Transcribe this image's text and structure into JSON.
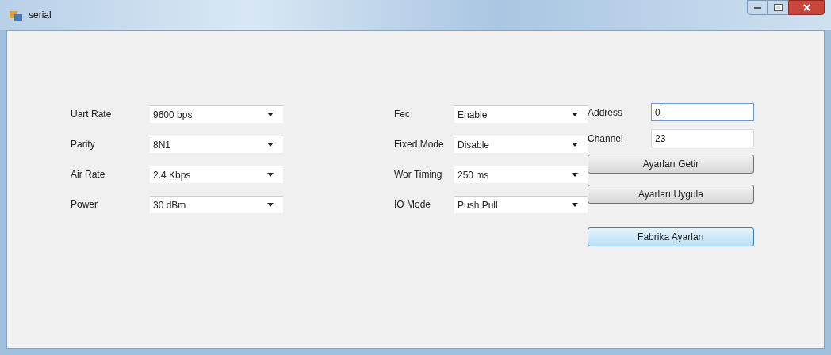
{
  "window": {
    "title": "serial"
  },
  "settings_left": [
    {
      "label": "Uart Rate",
      "value": "9600 bps"
    },
    {
      "label": "Parity",
      "value": "8N1"
    },
    {
      "label": "Air Rate",
      "value": "2.4 Kbps"
    },
    {
      "label": "Power",
      "value": "30 dBm"
    }
  ],
  "settings_middle": [
    {
      "label": "Fec",
      "value": "Enable"
    },
    {
      "label": "Fixed Mode",
      "value": "Disable"
    },
    {
      "label": "Wor Timing",
      "value": "250 ms"
    },
    {
      "label": "IO Mode",
      "value": "Push Pull"
    }
  ],
  "fields": [
    {
      "label": "Address",
      "value": "0",
      "focused": true
    },
    {
      "label": "Channel",
      "value": "23",
      "focused": false
    }
  ],
  "buttons": [
    {
      "label": "Ayarları Getir",
      "highlighted": false
    },
    {
      "label": "Ayarları Uygula",
      "highlighted": false
    },
    {
      "label": "Fabrika Ayarları",
      "highlighted": true
    }
  ]
}
